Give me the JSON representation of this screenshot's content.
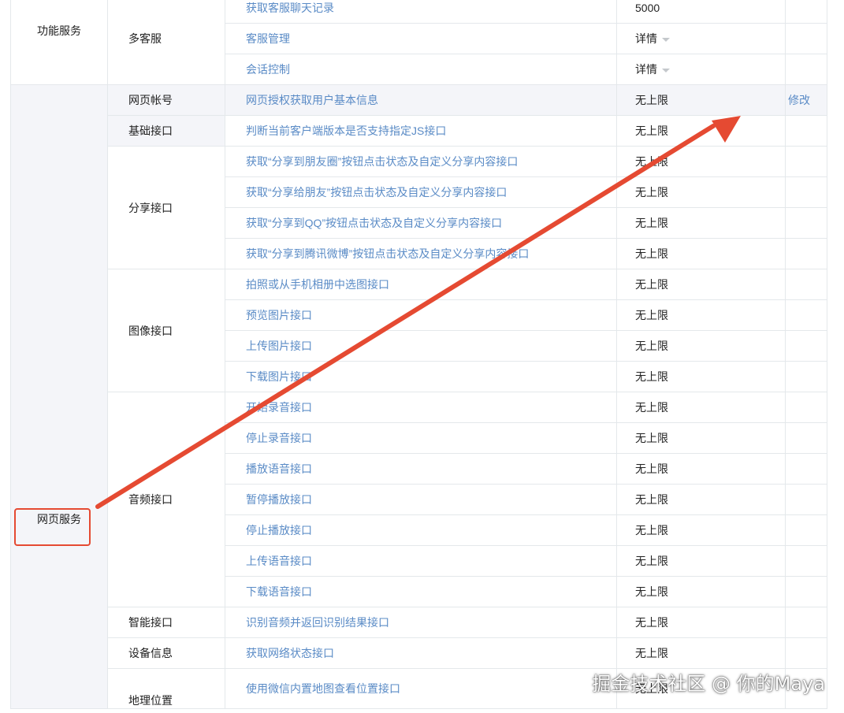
{
  "colors": {
    "link": "#5a8bc6",
    "annotation": "#e54a32",
    "group_bg": "#f4f5f9"
  },
  "groups": {
    "feature_service": "功能服务",
    "web_service": "网页服务"
  },
  "sub": {
    "customer_service": "多客服",
    "web_account": "网页帐号",
    "basic_api": "基础接口",
    "share_api": "分享接口",
    "image_api": "图像接口",
    "audio_api": "音频接口",
    "smart_api": "智能接口",
    "device_info": "设备信息",
    "location_api": "地理位置"
  },
  "rows": [
    {
      "name": "获取客服聊天记录",
      "quota": "5000"
    },
    {
      "name": "客服管理",
      "quota": "详情"
    },
    {
      "name": "会话控制",
      "quota": "详情"
    },
    {
      "name": "网页授权获取用户基本信息",
      "quota": "无上限",
      "action": "修改"
    },
    {
      "name": "判断当前客户端版本是否支持指定JS接口",
      "quota": "无上限"
    },
    {
      "name": "获取“分享到朋友圈”按钮点击状态及自定义分享内容接口",
      "quota": "无上限"
    },
    {
      "name": "获取“分享给朋友”按钮点击状态及自定义分享内容接口",
      "quota": "无上限"
    },
    {
      "name": "获取“分享到QQ”按钮点击状态及自定义分享内容接口",
      "quota": "无上限"
    },
    {
      "name": "获取“分享到腾讯微博”按钮点击状态及自定义分享内容接口",
      "quota": "无上限"
    },
    {
      "name": "拍照或从手机相册中选图接口",
      "quota": "无上限"
    },
    {
      "name": "预览图片接口",
      "quota": "无上限"
    },
    {
      "name": "上传图片接口",
      "quota": "无上限"
    },
    {
      "name": "下载图片接口",
      "quota": "无上限"
    },
    {
      "name": "开始录音接口",
      "quota": "无上限"
    },
    {
      "name": "停止录音接口",
      "quota": "无上限"
    },
    {
      "name": "播放语音接口",
      "quota": "无上限"
    },
    {
      "name": "暂停播放接口",
      "quota": "无上限"
    },
    {
      "name": "停止播放接口",
      "quota": "无上限"
    },
    {
      "name": "上传语音接口",
      "quota": "无上限"
    },
    {
      "name": "下载语音接口",
      "quota": "无上限"
    },
    {
      "name": "识别音频并返回识别结果接口",
      "quota": "无上限"
    },
    {
      "name": "获取网络状态接口",
      "quota": "无上限"
    },
    {
      "name": "使用微信内置地图查看位置接口",
      "quota": "无上限"
    }
  ],
  "watermark": "掘金技术社区 @ 你的Maya"
}
